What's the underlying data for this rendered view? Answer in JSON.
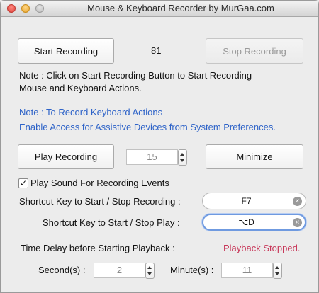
{
  "window": {
    "title": "Mouse & Keyboard Recorder by MurGaa.com"
  },
  "buttons": {
    "start_recording": "Start Recording",
    "stop_recording": "Stop Recording",
    "play_recording": "Play Recording",
    "minimize": "Minimize"
  },
  "counter": "81",
  "notes": {
    "line1": "Note : Click on Start Recording Button to Start Recording",
    "line2": "Mouse and Keyboard Actions.",
    "blue1": "Note : To Record Keyboard Actions",
    "blue2": "Enable Access for Assistive Devices from System Preferences."
  },
  "play_count": "15",
  "checkbox": {
    "label": "Play Sound For Recording Events",
    "checked": true,
    "mark": "✓"
  },
  "shortcuts": {
    "record_label": "Shortcut Key to Start / Stop Recording :",
    "record_value": "F7",
    "play_label": "Shortcut Key to Start / Stop Play  :",
    "play_value": "⌥D",
    "clear_glyph": "×"
  },
  "delay": {
    "label": "Time Delay before Starting Playback :",
    "status": "Playback Stopped.",
    "status_color": "#c8385a",
    "seconds_label": "Second(s) :",
    "seconds_value": "2",
    "minutes_label": "Minute(s) :",
    "minutes_value": "11"
  },
  "icons": {
    "close": "close-icon",
    "minimize": "minimize-icon",
    "zoom": "zoom-icon",
    "clear": "clear-icon",
    "stepper_up": "arrow-up-icon",
    "stepper_down": "arrow-down-icon"
  }
}
